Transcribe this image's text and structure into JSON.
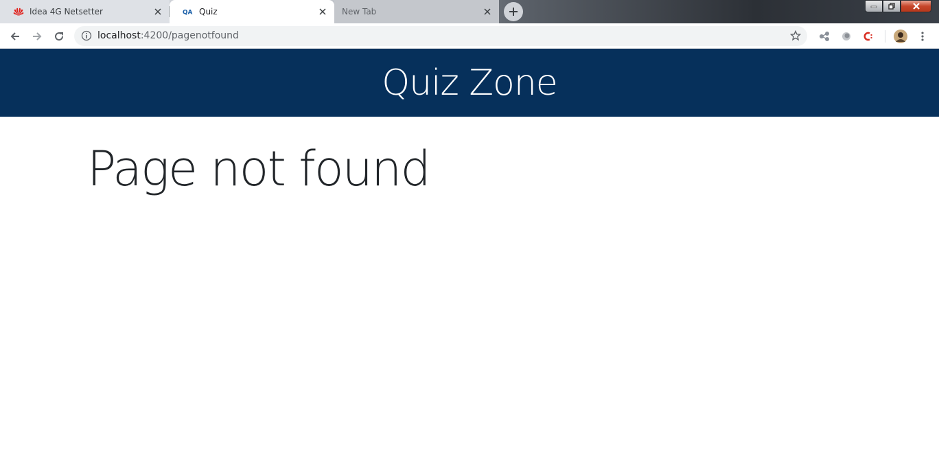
{
  "browser": {
    "tabs": [
      {
        "title": "Idea 4G Netsetter",
        "icon": "huawei-logo-icon",
        "active": false
      },
      {
        "title": "Quiz",
        "icon": "qa-logo-icon",
        "active": true
      },
      {
        "title": "New Tab",
        "icon": "",
        "active": false
      }
    ],
    "address_bar": {
      "host": "localhost",
      "path": ":4200/pagenotfound"
    },
    "extensions": [
      "puzzle-extension-icon",
      "circle-extension-icon",
      "c-extension-icon"
    ],
    "colors": {
      "tab_strip": "#dee1e6",
      "active_tab": "#ffffff",
      "close_button": "#c7462b"
    }
  },
  "page": {
    "site_title": "Quiz Zone",
    "heading": "Page not found",
    "colors": {
      "header_bg": "#06305b",
      "header_text": "#ffffff",
      "heading_text": "#212529"
    }
  }
}
